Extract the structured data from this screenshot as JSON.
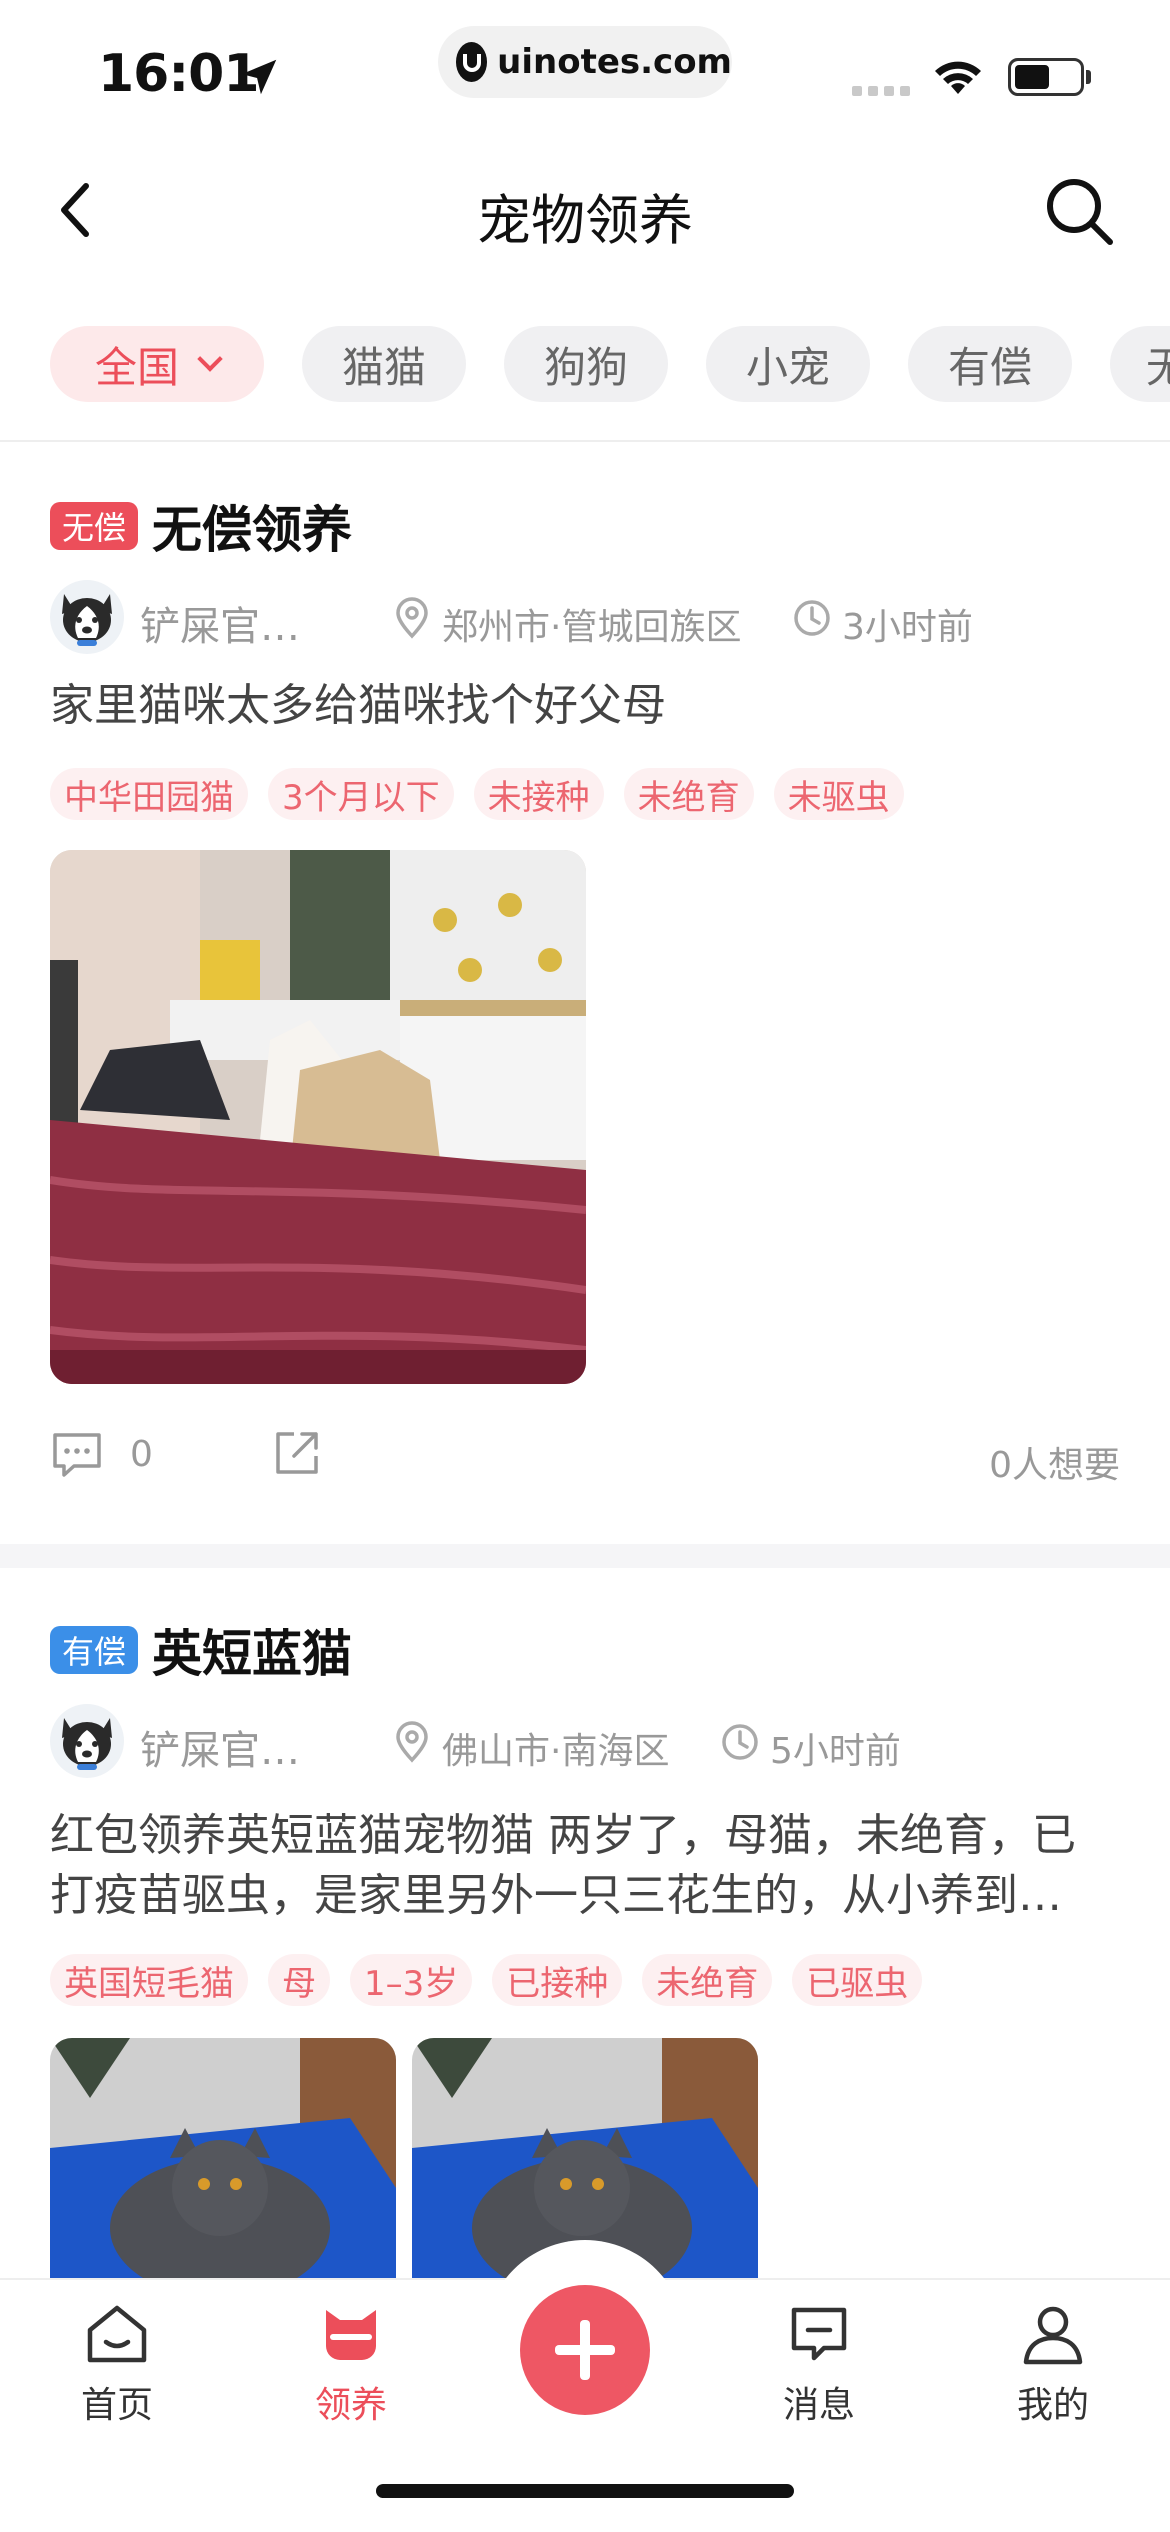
{
  "status_bar": {
    "time": "16:01",
    "url": "uinotes.com"
  },
  "nav": {
    "title": "宠物领养",
    "back_icon": "chevron-left-icon",
    "search_icon": "search-icon"
  },
  "filters": [
    {
      "label": "全国",
      "active": true
    },
    {
      "label": "猫猫",
      "active": false
    },
    {
      "label": "狗狗",
      "active": false
    },
    {
      "label": "小宠",
      "active": false
    },
    {
      "label": "有偿",
      "active": false
    },
    {
      "label": "无",
      "active": false
    }
  ],
  "posts": [
    {
      "badge": "无偿",
      "title": "无偿领养",
      "user": "铲屎官…",
      "location": "郑州市·管城回族区",
      "time_ago": "3小时前",
      "description": "家里猫咪太多给猫咪找个好父母",
      "tags": [
        "中华田园猫",
        "3个月以下",
        "未接种",
        "未绝育",
        "未驱虫"
      ],
      "comment_count": "0",
      "want_count": "0人想要"
    },
    {
      "badge": "有偿",
      "title": "英短蓝猫",
      "user": "铲屎官…",
      "location": "佛山市·南海区",
      "time_ago": "5小时前",
      "description_line1": "红包领养英短蓝猫宠物猫 两岁了，母猫，未绝育，已",
      "description_line2": "打疫苗驱虫，是家里另外一只三花生的，从小养到…",
      "tags": [
        "英国短毛猫",
        "母",
        "1–3岁",
        "已接种",
        "未绝育",
        "已驱虫"
      ]
    }
  ],
  "tabbar": {
    "items": [
      {
        "label": "首页",
        "icon": "home-icon"
      },
      {
        "label": "领养",
        "icon": "cat-icon",
        "active": true
      },
      {
        "label": "消息",
        "icon": "message-icon"
      },
      {
        "label": "我的",
        "icon": "user-icon"
      }
    ],
    "fab_icon": "plus-icon"
  },
  "colors": {
    "accent": "#ec4e5a",
    "paid_badge": "#3b8fe8",
    "tag_bg": "#fdf0f1",
    "chip_bg": "#f0f0f2"
  }
}
